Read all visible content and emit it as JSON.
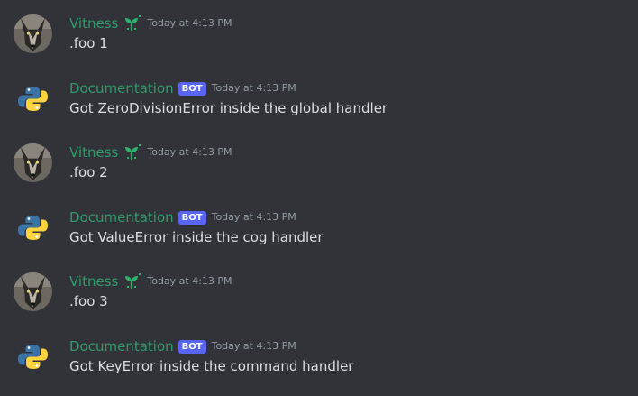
{
  "messages": [
    {
      "author": "Vitness",
      "avatar": "wolf-avatar",
      "role_icon": "sprout-icon",
      "timestamp": "Today at 4:13 PM",
      "content": ".foo 1"
    },
    {
      "author": "Documentation",
      "avatar": "python-logo-avatar",
      "badge": "BOT",
      "timestamp": "Today at 4:13 PM",
      "content": "Got ZeroDivisionError inside the global handler"
    },
    {
      "author": "Vitness",
      "avatar": "wolf-avatar",
      "role_icon": "sprout-icon",
      "timestamp": "Today at 4:13 PM",
      "content": ".foo 2"
    },
    {
      "author": "Documentation",
      "avatar": "python-logo-avatar",
      "badge": "BOT",
      "timestamp": "Today at 4:13 PM",
      "content": "Got ValueError inside the cog handler"
    },
    {
      "author": "Vitness",
      "avatar": "wolf-avatar",
      "role_icon": "sprout-icon",
      "timestamp": "Today at 4:13 PM",
      "content": ".foo 3"
    },
    {
      "author": "Documentation",
      "avatar": "python-logo-avatar",
      "badge": "BOT",
      "timestamp": "Today at 4:13 PM",
      "content": "Got KeyError inside the command handler"
    }
  ],
  "colors": {
    "background": "#313338",
    "username": "#2f9b6c",
    "message_text": "#dbdee1",
    "timestamp": "#949ba4",
    "bot_badge": "#5865f2",
    "python_blue": "#3a74a7",
    "python_yellow": "#fdd33f"
  }
}
